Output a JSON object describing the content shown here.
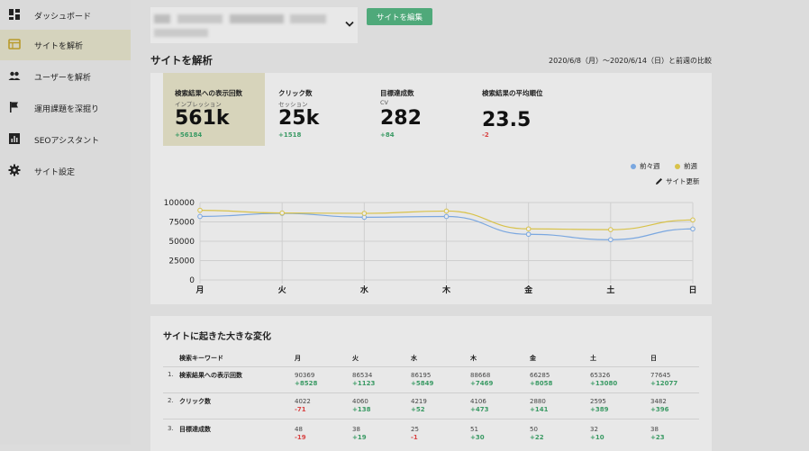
{
  "sidebar": {
    "items": [
      {
        "label": "ダッシュボード",
        "icon": "dashboard-icon"
      },
      {
        "label": "サイトを解析",
        "icon": "web-icon"
      },
      {
        "label": "ユーザーを解析",
        "icon": "people-icon"
      },
      {
        "label": "運用課題を深掘り",
        "icon": "flag-icon"
      },
      {
        "label": "SEOアシスタント",
        "icon": "bar-chart-icon"
      },
      {
        "label": "サイト設定",
        "icon": "gear-icon"
      }
    ]
  },
  "header": {
    "edit_button": "サイトを編集"
  },
  "page": {
    "title": "サイトを解析",
    "period": "2020/6/8（月）〜2020/6/14（日）と前週の比較"
  },
  "kpis": [
    {
      "title": "検索結果への表示回数",
      "sub": "インプレッション",
      "value": "561k",
      "delta": "+56184"
    },
    {
      "title": "クリック数",
      "sub": "セッション",
      "value": "25k",
      "delta": "+1518"
    },
    {
      "title": "目標達成数",
      "sub": "CV",
      "value": "282",
      "delta": "+84"
    },
    {
      "title": "検索結果の平均順位",
      "sub": "",
      "value": "23.5",
      "delta": "-2"
    }
  ],
  "legend": {
    "prev2": "前々週",
    "prev": "前週"
  },
  "site_update": "サイト更新",
  "colors": {
    "prev2": "#7aa7e0",
    "prev": "#d8c24a",
    "positive": "#3a9a64",
    "negative": "#d84343",
    "accent": "#4fa97a"
  },
  "chart_data": {
    "type": "line",
    "categories": [
      "月",
      "火",
      "水",
      "木",
      "金",
      "土",
      "日"
    ],
    "series": [
      {
        "name": "前々週",
        "values": [
          82000,
          86000,
          81000,
          82000,
          59000,
          52000,
          66000
        ]
      },
      {
        "name": "前週",
        "values": [
          90000,
          86500,
          86000,
          89000,
          66000,
          65000,
          77500
        ]
      }
    ],
    "yticks": [
      "100000",
      "75000",
      "50000",
      "25000",
      "0"
    ],
    "ylim": [
      0,
      100000
    ],
    "grid": true,
    "legend_position": "top-right"
  },
  "changes": {
    "title": "サイトに起きた大きな変化",
    "header": [
      "検索キーワード",
      "月",
      "火",
      "水",
      "木",
      "金",
      "土",
      "日"
    ],
    "rows": [
      {
        "rank": "1.",
        "label": "検索結果への表示回数",
        "values": [
          "90369",
          "86534",
          "86195",
          "88668",
          "66285",
          "65326",
          "77645"
        ],
        "deltas": [
          "+8528",
          "+1123",
          "+5849",
          "+7469",
          "+8058",
          "+13080",
          "+12077"
        ]
      },
      {
        "rank": "2.",
        "label": "クリック数",
        "values": [
          "4022",
          "4060",
          "4219",
          "4106",
          "2880",
          "2595",
          "3482"
        ],
        "deltas": [
          "-71",
          "+138",
          "+52",
          "+473",
          "+141",
          "+389",
          "+396"
        ]
      },
      {
        "rank": "3.",
        "label": "目標達成数",
        "values": [
          "48",
          "38",
          "25",
          "51",
          "50",
          "32",
          "38"
        ],
        "deltas": [
          "-19",
          "+19",
          "-1",
          "+30",
          "+22",
          "+10",
          "+23"
        ]
      }
    ]
  }
}
